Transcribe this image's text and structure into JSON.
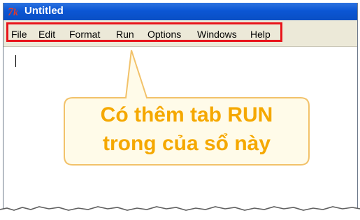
{
  "window": {
    "title": "Untitled",
    "app_icon": "tk-feather-icon"
  },
  "menu": {
    "items": [
      {
        "label": "File"
      },
      {
        "label": "Edit"
      },
      {
        "label": "Format"
      },
      {
        "label": "Run"
      },
      {
        "label": "Options"
      },
      {
        "label": "Windows"
      },
      {
        "label": "Help"
      }
    ]
  },
  "callout": {
    "line1": "Có thêm tab RUN",
    "line2": "trong của sổ này",
    "text_color": "#f5a800",
    "fill_color": "#fffbe9",
    "border_color": "#f2c26a"
  },
  "colors": {
    "title_bar": "#0b56d4",
    "menu_highlight": "#e8141b",
    "menu_bar": "#ece9d8"
  }
}
